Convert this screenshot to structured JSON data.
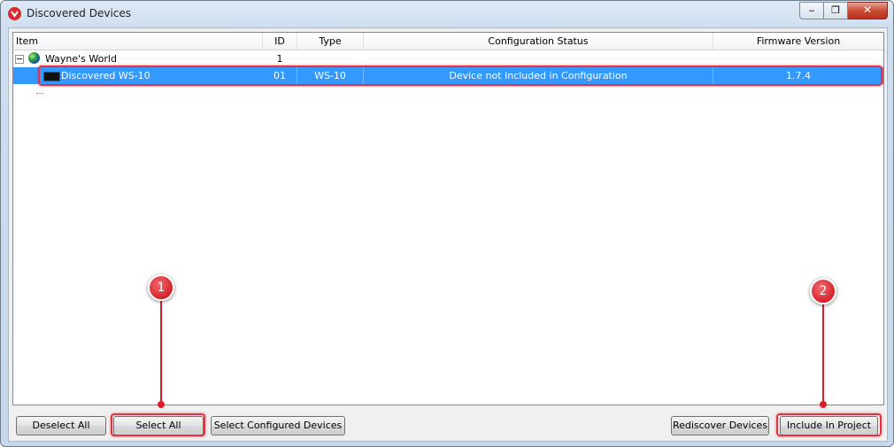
{
  "window": {
    "title": "Discovered Devices"
  },
  "caption": {
    "minimize": "‒",
    "maximize": "❐",
    "close": "✕"
  },
  "columns": [
    "Item",
    "ID",
    "Type",
    "Configuration Status",
    "Firmware Version"
  ],
  "tree": {
    "group": {
      "name": "Wayne's World",
      "id": "1",
      "expander": "−"
    },
    "device": {
      "name": "Discovered WS-10",
      "id": "01",
      "type": "WS-10",
      "status": "Device not Included in Configuration",
      "firmware": "1.7.4",
      "selected": true
    }
  },
  "buttons": {
    "deselect_all": "Deselect All",
    "select_all": "Select All",
    "select_configured": "Select Configured Devices",
    "rediscover": "Rediscover Devices",
    "include": "Include In Project"
  },
  "markers": [
    "1",
    "2"
  ],
  "colors": {
    "selection": "#3399ff",
    "callout": "#d9202a"
  }
}
